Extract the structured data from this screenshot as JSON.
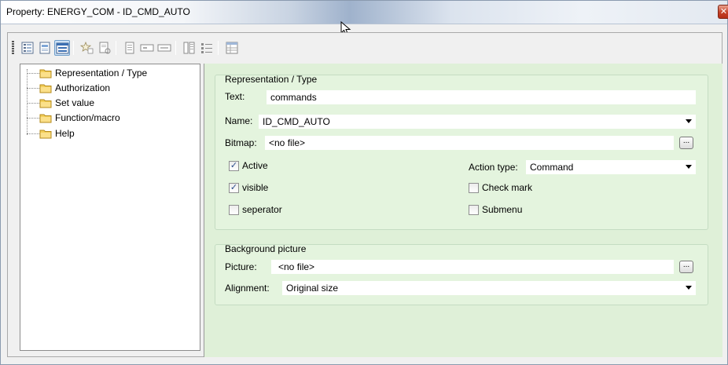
{
  "window": {
    "title": "Property: ENERGY_COM - ID_CMD_AUTO",
    "close_glyph": "✕"
  },
  "toolbar": {
    "buttons": [
      "view-list-icon",
      "page-icon",
      "panel-icon",
      "star-icon",
      "page-search-icon",
      "document-icon",
      "field-icon",
      "field-alt-icon",
      "sort-icon",
      "list-icon",
      "grid-icon"
    ],
    "active": "panel-icon"
  },
  "tree": {
    "items": [
      {
        "label": "Representation / Type"
      },
      {
        "label": "Authorization"
      },
      {
        "label": "Set value"
      },
      {
        "label": "Function/macro"
      },
      {
        "label": "Help"
      }
    ]
  },
  "representation": {
    "group_title": "Representation / Type",
    "text_label": "Text:",
    "text_value": "commands",
    "name_label": "Name:",
    "name_value": "ID_CMD_AUTO",
    "bitmap_label": "Bitmap:",
    "bitmap_value": "<no file>",
    "browse_label": "...",
    "active_label": "Active",
    "active_checked": true,
    "visible_label": "visible",
    "visible_checked": true,
    "separator_label": "seperator",
    "separator_checked": false,
    "action_type_label": "Action type:",
    "action_type_value": "Command",
    "check_mark_label": "Check mark",
    "check_mark_checked": false,
    "submenu_label": "Submenu",
    "submenu_checked": false,
    "check_glyph": "✓"
  },
  "background": {
    "group_title": "Background picture",
    "picture_label": "Picture:",
    "picture_value": "<no file>",
    "browse_label": "...",
    "alignment_label": "Alignment:",
    "alignment_value": "Original size"
  },
  "colors": {
    "panel_bg": "#dff0d8",
    "group_bg": "#e4f4de",
    "folder": "#f3cf5a",
    "check": "#2a4c8a"
  }
}
